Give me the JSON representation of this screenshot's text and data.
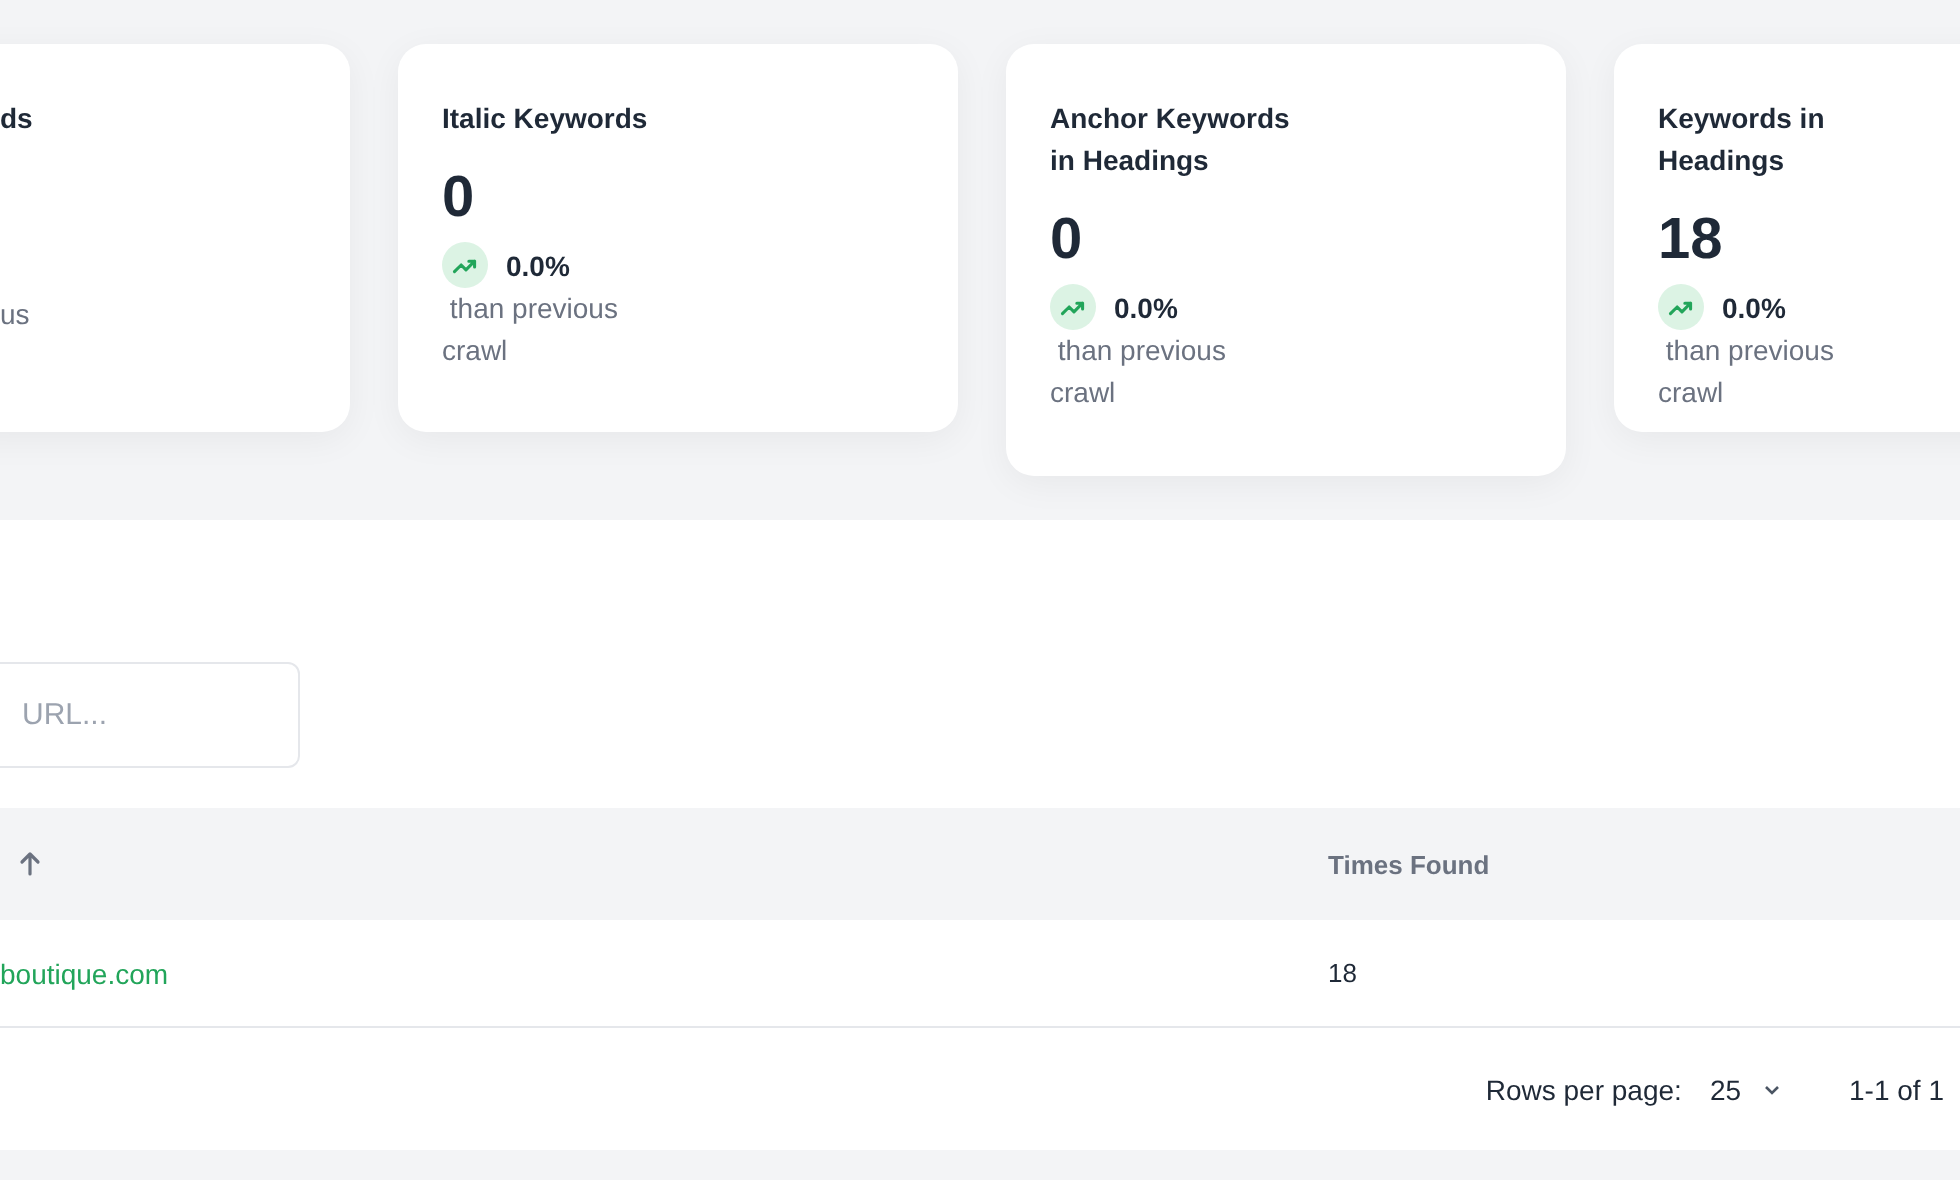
{
  "stat_cards": [
    {
      "title": "ds",
      "caption": "us"
    },
    {
      "title": "Italic Keywords",
      "value": "0",
      "change": "0.0%",
      "caption": " than previous crawl"
    },
    {
      "title": "Anchor Keywords in Headings",
      "value": "0",
      "change": "0.0%",
      "caption": " than previous crawl"
    },
    {
      "title": "Keywords in Headings",
      "value": "18",
      "change": "0.0%",
      "caption": " than previous crawl"
    }
  ],
  "search": {
    "placeholder": "URL..."
  },
  "table": {
    "columns": [
      {
        "sort_ascending": true
      },
      {
        "label": "Times Found"
      }
    ],
    "rows": [
      [
        "boutique.com",
        "18"
      ]
    ]
  },
  "pagination": {
    "rows_per_page_label": "Rows per page:",
    "rows_per_page": "25",
    "range": "1-1 of 1"
  }
}
